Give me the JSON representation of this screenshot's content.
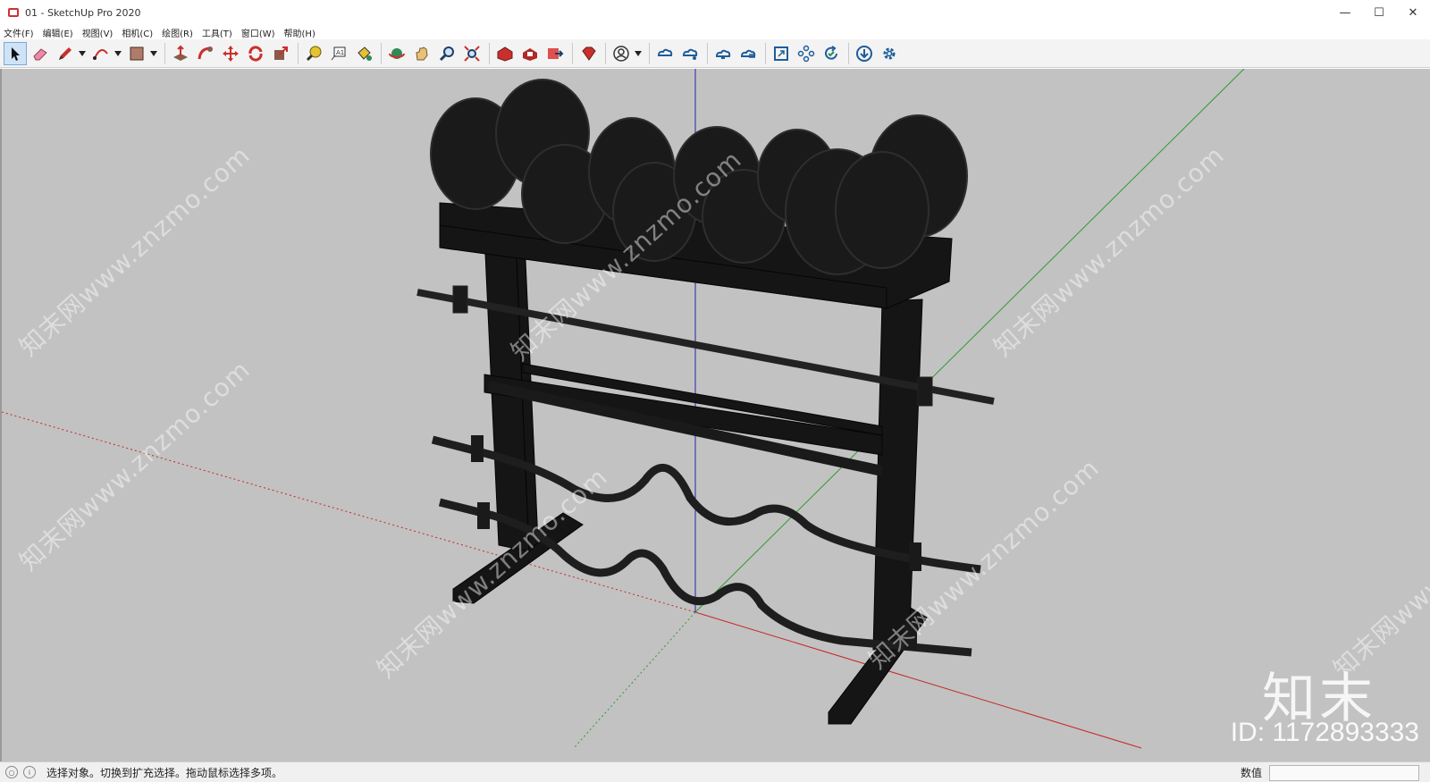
{
  "window": {
    "title": "01 - SketchUp Pro 2020",
    "controls": {
      "minimize": "—",
      "maximize": "☐",
      "close": "✕"
    }
  },
  "menu": [
    "文件(F)",
    "编辑(E)",
    "视图(V)",
    "相机(C)",
    "绘图(R)",
    "工具(T)",
    "窗口(W)",
    "帮助(H)"
  ],
  "toolbar": {
    "tools": [
      "select-icon",
      "eraser-icon",
      "pencil-icon",
      "arc-icon",
      "rectangle-icon",
      "push-pull-icon",
      "follow-me-icon",
      "move-icon",
      "rotate-icon",
      "scale-icon",
      "tape-measure-icon",
      "text-icon",
      "paint-bucket-icon",
      "orbit-icon",
      "pan-icon",
      "zoom-icon",
      "zoom-extents-icon",
      "warehouse-icon",
      "extension-warehouse-icon",
      "send-to-layout-icon",
      "ruby-console-icon",
      "account-icon",
      "trimble-connect-icon",
      "share-icon",
      "cloud-upload-icon",
      "cloud-sync-icon",
      "fullscreen-icon",
      "components-icon",
      "refresh-icon",
      "download-icon",
      "settings-icon"
    ]
  },
  "viewport": {
    "watermark": "知末网www.znzmo.com",
    "brand": "知末",
    "id": "ID: 1172893333",
    "background": "#c2c2c2",
    "axes": {
      "red": "#c62828",
      "green": "#2e9a2e",
      "blue": "#2222aa"
    }
  },
  "status": {
    "message": "选择对象。切换到扩充选择。拖动鼠标选择多项。",
    "measure_label": "数值",
    "measure_value": ""
  }
}
